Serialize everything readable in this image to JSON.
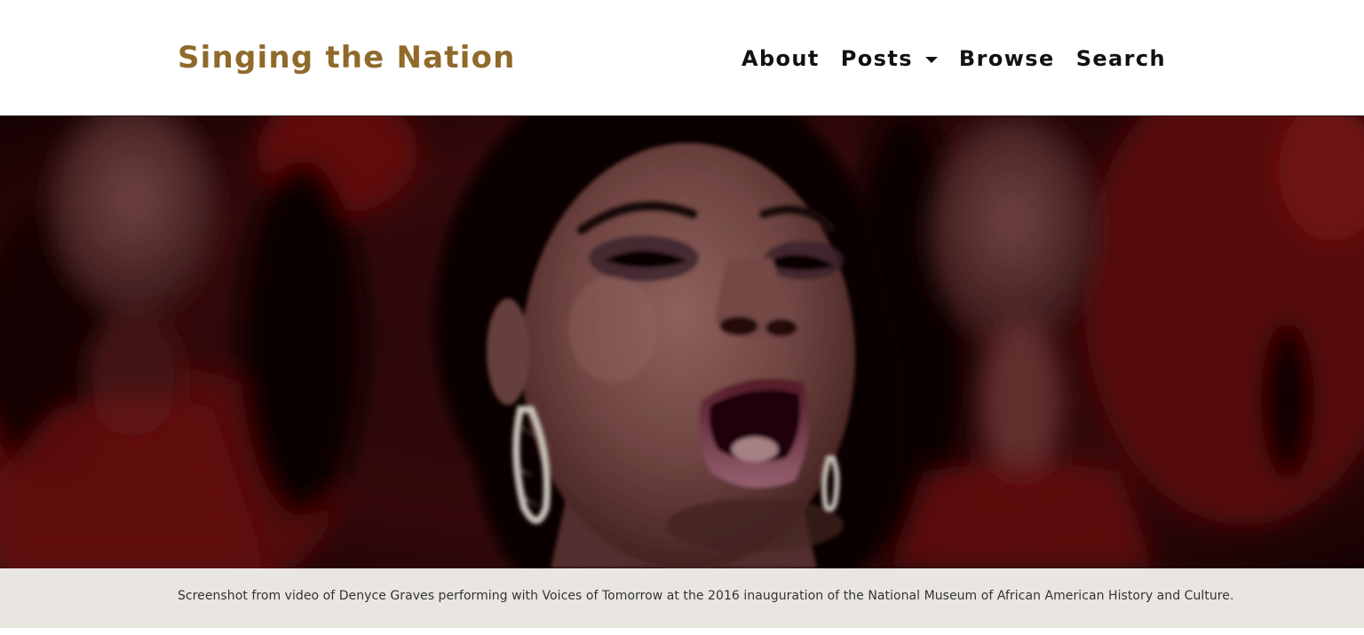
{
  "site": {
    "brand": "Singing the Nation"
  },
  "nav": {
    "items": [
      {
        "label": "About",
        "dropdown": false
      },
      {
        "label": "Posts",
        "dropdown": true
      },
      {
        "label": "Browse",
        "dropdown": false
      },
      {
        "label": "Search",
        "dropdown": false
      }
    ]
  },
  "hero": {
    "caption": "Screenshot from video of Denyce Graves performing with Voices of Tomorrow at the 2016 inauguration of the National Museum of African American History and Culture."
  },
  "colors": {
    "brand": "#8f6a2a",
    "nav_text": "#111111",
    "caption_bg": "#e9e6e1",
    "caption_text": "#333333"
  }
}
